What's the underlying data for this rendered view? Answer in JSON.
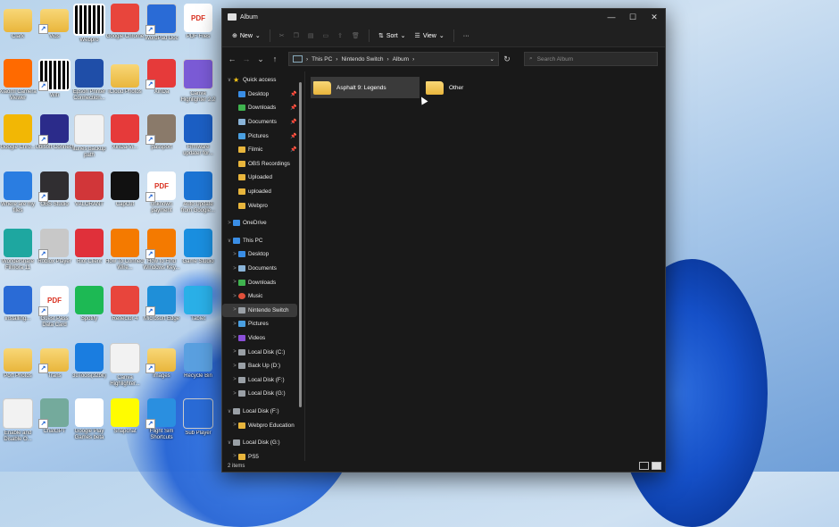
{
  "desktop": {
    "icons": [
      {
        "label": "Clark",
        "kind": "folder",
        "color": "#e9b63c"
      },
      {
        "label": "Vids",
        "kind": "folder",
        "color": "#e9b63c"
      },
      {
        "label": "Webpro",
        "kind": "qr",
        "color": "#ffffff"
      },
      {
        "label": "Google Chrome",
        "kind": "app",
        "color": "#e8453c"
      },
      {
        "label": "WordPad Doc",
        "kind": "doc",
        "color": "#2a6bd6"
      },
      {
        "label": "PDF Files",
        "kind": "pdf",
        "color": "#d9301f"
      },
      {
        "label": "Xiaomi Camera Viewer",
        "kind": "app",
        "color": "#ff6a00"
      },
      {
        "label": "Wifi",
        "kind": "qr",
        "color": "#ffffff"
      },
      {
        "label": "Epson Printer Connection...",
        "kind": "app",
        "color": "#1f4ea8"
      },
      {
        "label": "iCloud Photos",
        "kind": "folder",
        "color": "#e9b63c"
      },
      {
        "label": "XinDa",
        "kind": "app",
        "color": "#e63a3a"
      },
      {
        "label": "Canva Highlighter 2.2",
        "kind": "doc",
        "color": "#7b5bd6"
      },
      {
        "label": "Google Chro...",
        "kind": "app",
        "color": "#f2b705"
      },
      {
        "label": "Ubisoft Connect",
        "kind": "app",
        "color": "#2b2b8a"
      },
      {
        "label": "itunes backup path",
        "kind": "doc",
        "color": "#f2f2f2"
      },
      {
        "label": "XinDa-Vi...",
        "kind": "app",
        "color": "#e63a3a"
      },
      {
        "label": "passport",
        "kind": "photo",
        "color": "#8a7a6a"
      },
      {
        "label": "Firmware updater for...",
        "kind": "app",
        "color": "#1c5fc4"
      },
      {
        "label": "Where are my files",
        "kind": "app",
        "color": "#2a7de1"
      },
      {
        "label": "OBS Studio",
        "kind": "app",
        "color": "#302e31"
      },
      {
        "label": "VALORANT",
        "kind": "app",
        "color": "#d13639"
      },
      {
        "label": "CapCut",
        "kind": "app",
        "color": "#111111"
      },
      {
        "label": "unknown payment",
        "kind": "pdf",
        "color": "#d9301f"
      },
      {
        "label": "Auto Update from Google...",
        "kind": "app",
        "color": "#1c74d4"
      },
      {
        "label": "Wondershare Filmora 11",
        "kind": "app",
        "color": "#1ea7a0"
      },
      {
        "label": "Roblox Player",
        "kind": "app",
        "color": "#c8c8c8"
      },
      {
        "label": "Riot Client",
        "kind": "app",
        "color": "#e0303a"
      },
      {
        "label": "How To Connect Wire...",
        "kind": "app",
        "color": "#f47a00"
      },
      {
        "label": "How to Find Windows Key...",
        "kind": "app",
        "color": "#f47a00"
      },
      {
        "label": "Game Studio",
        "kind": "app",
        "color": "#1a8fe0"
      },
      {
        "label": "installing...",
        "kind": "app",
        "color": "#2a6bd6"
      },
      {
        "label": "Guest Pass Data Card",
        "kind": "pdf",
        "color": "#d9301f"
      },
      {
        "label": "Spotify",
        "kind": "app",
        "color": "#1db954"
      },
      {
        "label": "Reflector 4",
        "kind": "app",
        "color": "#e8453c"
      },
      {
        "label": "Microsoft Edge",
        "kind": "app",
        "color": "#1f8fd8"
      },
      {
        "label": "Tablet",
        "kind": "app",
        "color": "#2ab0e8"
      },
      {
        "label": "Port Photos",
        "kind": "folder",
        "color": "#e9b63c"
      },
      {
        "label": "Trans",
        "kind": "folder",
        "color": "#e9b63c"
      },
      {
        "label": "3uTools(32bit)",
        "kind": "app",
        "color": "#1a7de0"
      },
      {
        "label": "Canva Highlighter...",
        "kind": "doc",
        "color": "#f2f2f2"
      },
      {
        "label": "images",
        "kind": "folder",
        "color": "#e9b63c"
      },
      {
        "label": "Recycle Bin",
        "kind": "app",
        "color": "#5aa0e0"
      },
      {
        "label": "Enable and Disable O...",
        "kind": "doc",
        "color": "#f2f2f2"
      },
      {
        "label": "ChatGPT",
        "kind": "app",
        "color": "#74aa9c"
      },
      {
        "label": "Google Play Games beta",
        "kind": "app",
        "color": "#ffffff"
      },
      {
        "label": "Snapchat",
        "kind": "app",
        "color": "#fffc00"
      },
      {
        "label": "Flight Sim Shortcuts",
        "kind": "app",
        "color": "#2a8fe0"
      },
      {
        "label": "Sub Player",
        "kind": "doc",
        "color": "#2a6bd6"
      }
    ]
  },
  "window": {
    "title": "Album",
    "controls": {
      "minimize": "—",
      "maximize": "☐",
      "close": "✕"
    },
    "toolbar": {
      "new_label": "New",
      "sort_label": "Sort",
      "view_label": "View",
      "more_label": "···"
    },
    "address": {
      "segments": [
        "This PC",
        "Nintendo Switch",
        "Album"
      ],
      "separator": "›"
    },
    "search": {
      "placeholder": "Search Album"
    },
    "nav": [
      {
        "label": "Quick access",
        "level": 0,
        "icon": "star",
        "color": "#f5c518",
        "chev": "∨"
      },
      {
        "label": "Desktop",
        "level": 1,
        "icon": "desktop",
        "color": "#3a8ee6",
        "pin": true
      },
      {
        "label": "Downloads",
        "level": 1,
        "icon": "download",
        "color": "#3fb34f",
        "pin": true
      },
      {
        "label": "Documents",
        "level": 1,
        "icon": "doc",
        "color": "#8ab4d8",
        "pin": true
      },
      {
        "label": "Pictures",
        "level": 1,
        "icon": "picture",
        "color": "#4a9fe0",
        "pin": true
      },
      {
        "label": "Filmic",
        "level": 1,
        "icon": "folder",
        "color": "#e8b53c",
        "pin": true
      },
      {
        "label": "OBS Recordings",
        "level": 1,
        "icon": "folder",
        "color": "#e8b53c"
      },
      {
        "label": "Uploaded",
        "level": 1,
        "icon": "folder",
        "color": "#e8b53c"
      },
      {
        "label": "uploaded",
        "level": 1,
        "icon": "folder",
        "color": "#e8b53c"
      },
      {
        "label": "Webpro",
        "level": 1,
        "icon": "folder",
        "color": "#e8b53c"
      },
      {
        "label": "",
        "level": -1
      },
      {
        "label": "OneDrive",
        "level": 0,
        "icon": "cloud",
        "color": "#3a8ee6",
        "chev": ">"
      },
      {
        "label": "",
        "level": -1
      },
      {
        "label": "This PC",
        "level": 0,
        "icon": "pc",
        "color": "#3a8ee6",
        "chev": "∨"
      },
      {
        "label": "Desktop",
        "level": 1,
        "icon": "desktop",
        "color": "#3a8ee6",
        "chev": ">"
      },
      {
        "label": "Documents",
        "level": 1,
        "icon": "doc",
        "color": "#8ab4d8",
        "chev": ">"
      },
      {
        "label": "Downloads",
        "level": 1,
        "icon": "download",
        "color": "#3fb34f",
        "chev": ">"
      },
      {
        "label": "Music",
        "level": 1,
        "icon": "music",
        "color": "#e0503a",
        "chev": ">"
      },
      {
        "label": "Nintendo Switch",
        "level": 1,
        "icon": "device",
        "color": "#9aa0a6",
        "chev": ">",
        "selected": true
      },
      {
        "label": "Pictures",
        "level": 1,
        "icon": "picture",
        "color": "#4a9fe0",
        "chev": ">"
      },
      {
        "label": "Videos",
        "level": 1,
        "icon": "video",
        "color": "#8a4fd8",
        "chev": ">"
      },
      {
        "label": "Local Disk (C:)",
        "level": 1,
        "icon": "disk",
        "color": "#9aa0a6",
        "chev": ">"
      },
      {
        "label": "Back Up (D:)",
        "level": 1,
        "icon": "disk",
        "color": "#9aa0a6",
        "chev": ">"
      },
      {
        "label": "Local Disk (F:)",
        "level": 1,
        "icon": "disk",
        "color": "#9aa0a6",
        "chev": ">"
      },
      {
        "label": "Local Disk (G:)",
        "level": 1,
        "icon": "disk",
        "color": "#9aa0a6",
        "chev": ">"
      },
      {
        "label": "",
        "level": -1
      },
      {
        "label": "Local Disk (F:)",
        "level": 0,
        "icon": "disk",
        "color": "#9aa0a6",
        "chev": "∨"
      },
      {
        "label": "Webpro Education",
        "level": 1,
        "icon": "folder",
        "color": "#e8b53c",
        "chev": ">"
      },
      {
        "label": "",
        "level": -1
      },
      {
        "label": "Local Disk (G:)",
        "level": 0,
        "icon": "disk",
        "color": "#9aa0a6",
        "chev": "∨"
      },
      {
        "label": "PS5",
        "level": 1,
        "icon": "folder",
        "color": "#e8b53c",
        "chev": ">"
      }
    ],
    "files": [
      {
        "name": "Asphalt 9: Legends",
        "hover": true
      },
      {
        "name": "Other",
        "hover": false
      }
    ],
    "status": {
      "count": "2 items"
    }
  }
}
